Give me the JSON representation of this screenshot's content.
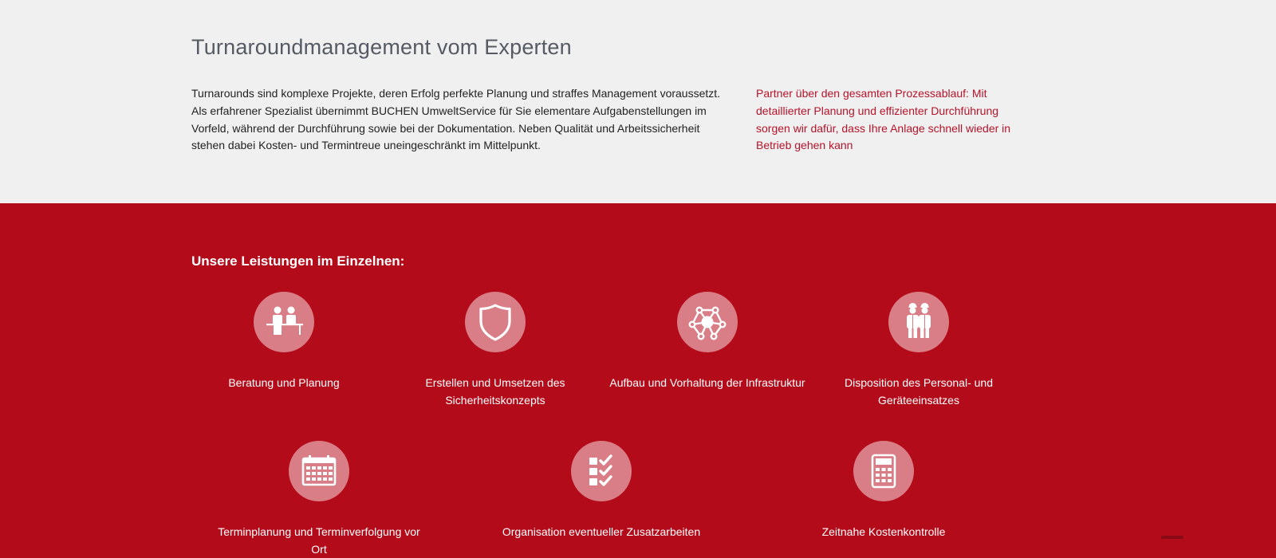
{
  "intro": {
    "title": "Turnaroundmanagement vom Experten",
    "lead": "Turnarounds sind komplexe Projekte, deren Erfolg perfekte Planung und straffes Management voraussetzt. Als erfahrener Spezialist übernimmt BUCHEN UmweltService für Sie elementare Aufgabenstellungen im Vorfeld, während der Durchführung sowie bei der Dokumentation. Neben Qualität und Arbeitssicherheit stehen dabei Kosten- und Termintreue uneingeschränkt im Mittelpunkt.",
    "aside": "Partner über den gesamten Prozessablauf: Mit detaillierter Planung und effizienter Durchführung sorgen wir dafür, dass Ihre Anlage schnell wieder in Betrieb gehen kann"
  },
  "services": {
    "heading": "Unsere Leistungen im Einzelnen:",
    "items": [
      {
        "label": "Beratung und Planung",
        "icon": "consultation-icon"
      },
      {
        "label": "Erstellen und Umsetzen des Sicherheitskonzepts",
        "icon": "shield-icon"
      },
      {
        "label": "Aufbau und Vorhaltung der Infrastruktur",
        "icon": "network-icon"
      },
      {
        "label": "Disposition des Personal- und Geräteeinsatzes",
        "icon": "workers-icon"
      },
      {
        "label": "Terminplanung und Terminverfolgung vor Ort",
        "icon": "calendar-icon"
      },
      {
        "label": "Organisation eventueller Zusatzarbeiten",
        "icon": "checklist-icon"
      },
      {
        "label": "Zeitnahe Kostenkontrolle",
        "icon": "calculator-icon"
      }
    ]
  },
  "colors": {
    "intro_bg": "#f0f0f0",
    "brand_red": "#b30b1a",
    "icon_circle": "#d97e86",
    "aside_text": "#b5132a"
  }
}
